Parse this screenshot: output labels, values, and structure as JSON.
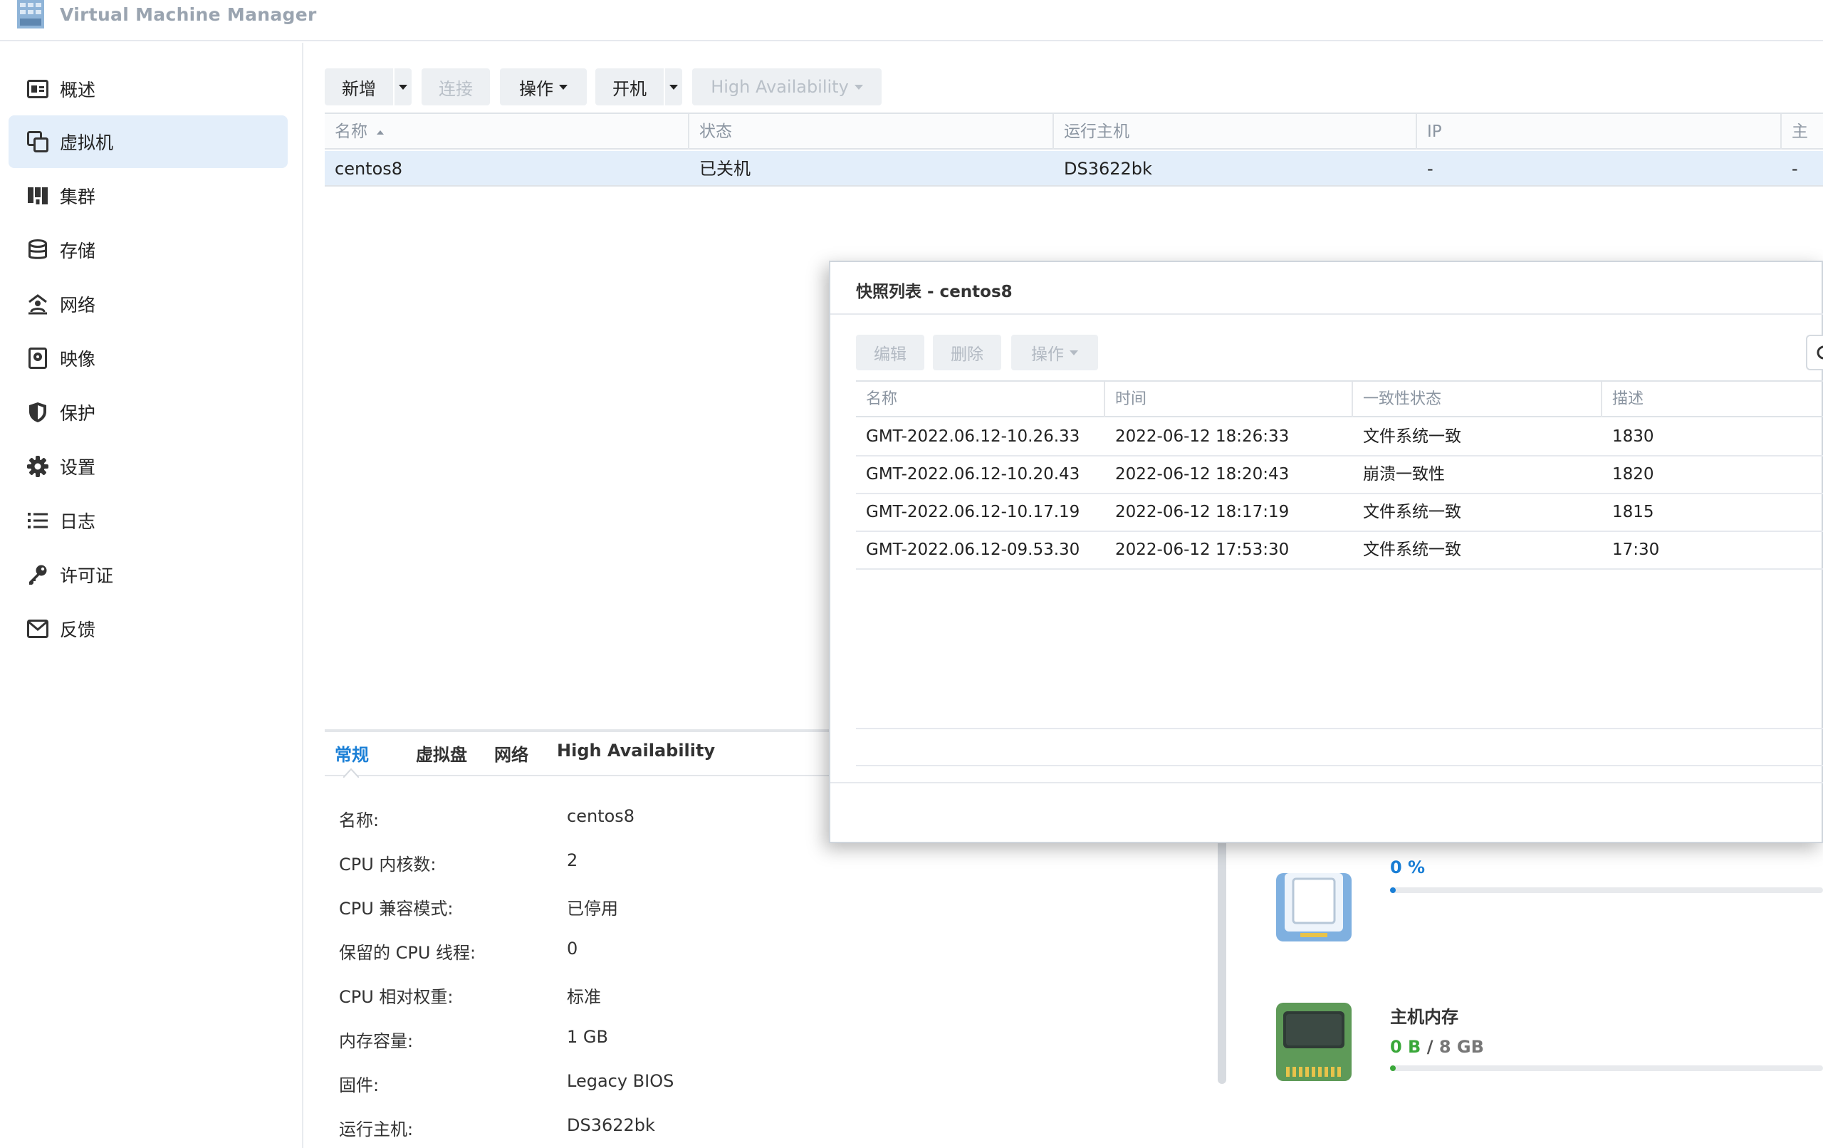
{
  "app": {
    "title": "Virtual Machine Manager"
  },
  "sidebar": {
    "items": [
      {
        "label": "概述",
        "icon": "overview-icon"
      },
      {
        "label": "虚拟机",
        "icon": "virtual-machine-icon",
        "active": true
      },
      {
        "label": "集群",
        "icon": "cluster-icon"
      },
      {
        "label": "存储",
        "icon": "storage-icon"
      },
      {
        "label": "网络",
        "icon": "network-icon"
      },
      {
        "label": "映像",
        "icon": "image-icon"
      },
      {
        "label": "保护",
        "icon": "shield-icon"
      },
      {
        "label": "设置",
        "icon": "gear-icon"
      },
      {
        "label": "日志",
        "icon": "log-list-icon"
      },
      {
        "label": "许可证",
        "icon": "key-icon"
      },
      {
        "label": "反馈",
        "icon": "mail-icon"
      }
    ]
  },
  "toolbar": {
    "create": "新增",
    "connect": "连接",
    "action": "操作",
    "power_on": "开机",
    "high_availability": "High Availability"
  },
  "vm_grid": {
    "columns": [
      "名称",
      "状态",
      "运行主机",
      "IP",
      "主机"
    ],
    "rows": [
      {
        "name": "centos8",
        "status": "已关机",
        "host": "DS3622bk",
        "ip": "-",
        "host2": "-"
      }
    ]
  },
  "detail": {
    "tabs": [
      "常规",
      "虚拟盘",
      "网络",
      "High Availability"
    ],
    "fields": [
      {
        "label": "名称:",
        "value": "centos8"
      },
      {
        "label": "CPU 内核数:",
        "value": "2"
      },
      {
        "label": "CPU 兼容模式:",
        "value": "已停用"
      },
      {
        "label": "保留的 CPU 线程:",
        "value": "0"
      },
      {
        "label": "CPU 相对权重:",
        "value": "标准"
      },
      {
        "label": "内存容量:",
        "value": "1 GB"
      },
      {
        "label": "固件:",
        "value": "Legacy BIOS"
      },
      {
        "label": "运行主机:",
        "value": "DS3622bk"
      }
    ],
    "resources": {
      "cpu": {
        "value": "0 %",
        "fraction": 0.0
      },
      "memory": {
        "title": "主机内存",
        "used": "0 B",
        "sep": "/",
        "total": "8 GB",
        "fraction": 0.0
      }
    }
  },
  "modal": {
    "title": "快照列表 - centos8",
    "buttons": {
      "edit": "编辑",
      "delete": "删除",
      "action": "操作"
    },
    "columns": [
      "名称",
      "时间",
      "一致性状态",
      "描述"
    ],
    "rows": [
      {
        "name": "GMT-2022.06.12-10.26.33",
        "time": "2022-06-12 18:26:33",
        "consistency": "文件系统一致",
        "desc": "1830"
      },
      {
        "name": "GMT-2022.06.12-10.20.43",
        "time": "2022-06-12 18:20:43",
        "consistency": "崩溃一致性",
        "desc": "1820"
      },
      {
        "name": "GMT-2022.06.12-10.17.19",
        "time": "2022-06-12 18:17:19",
        "consistency": "文件系统一致",
        "desc": "1815"
      },
      {
        "name": "GMT-2022.06.12-09.53.30",
        "time": "2022-06-12 17:53:30",
        "consistency": "文件系统一致",
        "desc": "17:30"
      }
    ]
  },
  "colors": {
    "accent": "#1a7fd6",
    "active_bg": "#e3eefa",
    "memory_green": "#3aa83a",
    "cpu_blue": "#1a7fd6"
  }
}
